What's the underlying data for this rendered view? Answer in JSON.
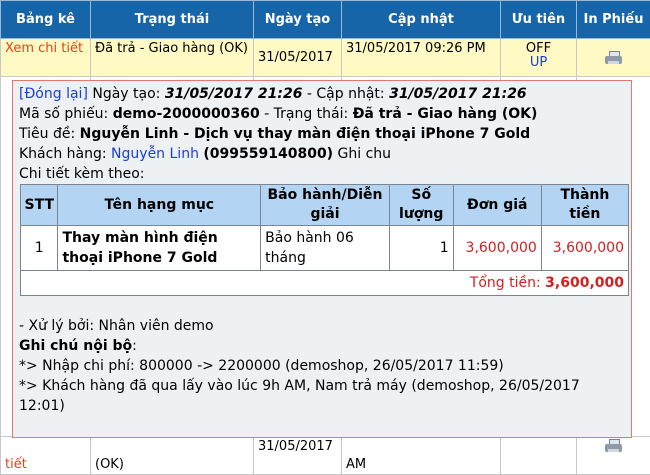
{
  "columns": [
    "Bảng kê",
    "Trạng thái",
    "Ngày tạo",
    "Cập nhật",
    "Ưu tiên",
    "In Phiếu"
  ],
  "rows": [
    {
      "link": "Xem chi tiết",
      "status": "Đã trả - Giao hàng (OK)",
      "created": "31/05/2017",
      "updated": "31/05/2017 09:26 PM",
      "prio_state": "OFF",
      "prio_action": "UP"
    },
    {
      "link": "tiết",
      "status": "(OK)",
      "created": "31/05/2017",
      "updated": "AM",
      "prio_state": "",
      "prio_action": ""
    }
  ],
  "detail": {
    "close_label": "[Đóng lại]",
    "created_label": "Ngày tạo:",
    "created_value": "31/05/2017 21:26",
    "updated_label": "- Cập nhật:",
    "updated_value": "31/05/2017 21:26",
    "ticket_label": "Mã số phiếu:",
    "ticket_value": "demo-2000000360",
    "status_label": "- Trạng thái:",
    "status_value": "Đã trả - Giao hàng (OK)",
    "title_label": "Tiêu đề:",
    "title_value": "Nguyễn Linh - Dịch vụ thay màn điện thoại iPhone 7 Gold",
    "customer_label": "Khách hàng:",
    "customer_name": "Nguyễn Linh",
    "customer_phone": "(099559140800)",
    "customer_note": "Ghi chu",
    "attach_label": "Chi tiết kèm theo:",
    "table_headers": [
      "STT",
      "Tên hạng mục",
      "Bảo hành/Diễn giải",
      "Số lượng",
      "Đơn giá",
      "Thành tiền"
    ],
    "items": [
      {
        "stt": "1",
        "name": "Thay màn hình điện thoại iPhone 7 Gold",
        "warranty": "Bảo hành 06 tháng",
        "qty": "1",
        "price": "3,600,000",
        "amount": "3,600,000"
      }
    ],
    "total_label": "Tổng tiền:",
    "total_value": "3,600,000",
    "handled_by": "- Xử lý bởi: Nhân viên demo",
    "notes_label": "Ghi chú nội bộ",
    "notes_colon": ":",
    "notes": [
      "*> Nhập chi phí: 800000 -> 2200000 (demoshop, 26/05/2017 11:59)",
      "*> Khách hàng đã qua lấy vào lúc 9h AM, Nam trả máy (demoshop, 26/05/2017 12:01)"
    ]
  },
  "colors": {
    "header_bg": "#1565a8",
    "highlight_row": "#fff9c4",
    "link": "#e0451b",
    "price": "#d21f1f",
    "popup_border": "#e07a6e"
  }
}
